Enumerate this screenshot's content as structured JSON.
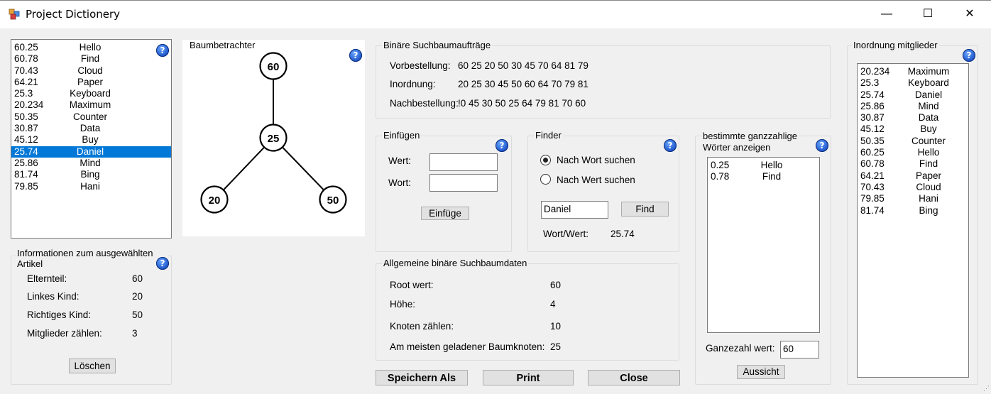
{
  "window": {
    "title": "Project Dictionery",
    "minimize": "—",
    "maximize": "☐",
    "close": "✕"
  },
  "colors": {
    "selection": "#0078d7",
    "help_icon": "#1a52c7"
  },
  "left_list": [
    {
      "value": "60.25",
      "word": "Hello"
    },
    {
      "value": "60.78",
      "word": "Find"
    },
    {
      "value": "70.43",
      "word": "Cloud"
    },
    {
      "value": "64.21",
      "word": "Paper"
    },
    {
      "value": "25.3",
      "word": "Keyboard"
    },
    {
      "value": "20.234",
      "word": "Maximum"
    },
    {
      "value": "50.35",
      "word": "Counter"
    },
    {
      "value": "30.87",
      "word": "Data"
    },
    {
      "value": "45.12",
      "word": "Buy"
    },
    {
      "value": "25.74",
      "word": "Daniel",
      "selected": true
    },
    {
      "value": "25.86",
      "word": "Mind"
    },
    {
      "value": "81.74",
      "word": "Bing"
    },
    {
      "value": "79.85",
      "word": "Hani"
    }
  ],
  "info": {
    "title": "Informationen zum ausgewählten Artikel",
    "parent_label": "Elternteil:",
    "parent_value": "60",
    "left_label": "Linkes Kind:",
    "left_value": "20",
    "right_label": "Richtiges Kind:",
    "right_value": "50",
    "members_label": "Mitglieder zählen:",
    "members_value": "3",
    "delete_button": "Löschen"
  },
  "tree_viewer": {
    "title": "Baumbetrachter",
    "nodes": {
      "root": "60",
      "mid": "25",
      "left": "20",
      "right": "50"
    }
  },
  "orders": {
    "title": "Binäre Suchbaumaufträge",
    "preorder_label": "Vorbestellung:",
    "preorder_value": "60 25 20 50 30 45 70 64 81 79",
    "inorder_label": "Inordnung:",
    "inorder_value": "20 25 30 45 50 60 64 70 79 81",
    "postorder_label": "Nachbestellung:",
    "postorder_value": "!0 45 30 50 25 64 79 81 70 60"
  },
  "insert": {
    "title": "Einfügen",
    "value_label": "Wert:",
    "value_input": "",
    "word_label": "Wort:",
    "word_input": "",
    "button": "Einfüge"
  },
  "finder": {
    "title": "Finder",
    "radio_word": "Nach Wort suchen",
    "radio_value": "Nach Wert suchen",
    "search_input": "Daniel",
    "find_button": "Find",
    "result_label": "Wort/Wert:",
    "result_value": "25.74"
  },
  "general": {
    "title": "Allgemeine binäre Suchbaumdaten",
    "root_label": "Root wert:",
    "root_value": "60",
    "height_label": "Höhe:",
    "height_value": "4",
    "count_label": "Knoten zählen:",
    "count_value": "10",
    "loaded_label": "Am meisten geladener Baumknoten:",
    "loaded_value": "25"
  },
  "integer_words": {
    "title_line1": "bestimmte ganzzahlige",
    "title_line2": "Wörter anzeigen",
    "items": [
      {
        "value": "0.25",
        "word": "Hello"
      },
      {
        "value": "0.78",
        "word": "Find"
      }
    ],
    "int_label": "Ganzezahl wert:",
    "int_input": "60",
    "view_button": "Aussicht"
  },
  "bottom_buttons": {
    "save_as": "Speichern Als",
    "print": "Print",
    "close": "Close"
  },
  "inorder_members": {
    "title": "Inordnung mitglieder",
    "items": [
      {
        "value": "20.234",
        "word": "Maximum"
      },
      {
        "value": "25.3",
        "word": "Keyboard"
      },
      {
        "value": "25.74",
        "word": "Daniel"
      },
      {
        "value": "25.86",
        "word": "Mind"
      },
      {
        "value": "30.87",
        "word": "Data"
      },
      {
        "value": "45.12",
        "word": "Buy"
      },
      {
        "value": "50.35",
        "word": "Counter"
      },
      {
        "value": "60.25",
        "word": "Hello"
      },
      {
        "value": "60.78",
        "word": "Find"
      },
      {
        "value": "64.21",
        "word": "Paper"
      },
      {
        "value": "70.43",
        "word": "Cloud"
      },
      {
        "value": "79.85",
        "word": "Hani"
      },
      {
        "value": "81.74",
        "word": "Bing"
      }
    ]
  },
  "help_glyph": "?"
}
